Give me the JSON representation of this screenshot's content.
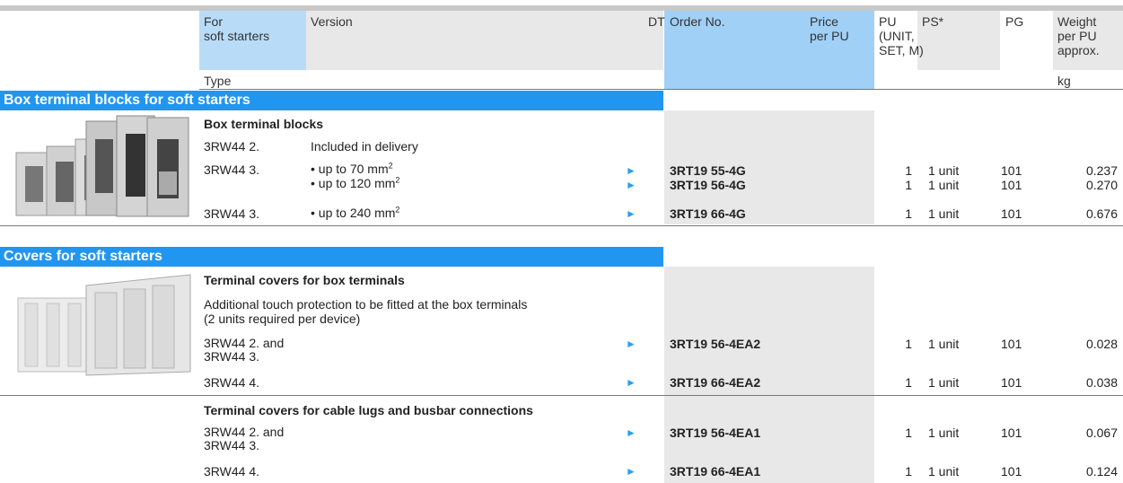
{
  "header": {
    "for_label": "For\nsoft starters",
    "version_label": "Version",
    "dt_label": "DT",
    "order_label": "Order No.",
    "price_label": "Price\nper PU",
    "pu_label": "PU\n(UNIT,\nSET, M)",
    "ps_label": "PS*",
    "pg_label": "PG",
    "weight_label": "Weight\nper PU\napprox.",
    "type_label": "Type",
    "kg_label": "kg"
  },
  "sections": {
    "box_title": "Box terminal blocks for soft starters",
    "covers_title": "Covers for soft starters"
  },
  "box": {
    "subtitle": "Box terminal blocks",
    "row0": {
      "type": "3RW44 2.",
      "version": "Included in delivery"
    },
    "row1": {
      "type": "3RW44 3.",
      "v1": "• up to 70 mm",
      "v2": "• up to 120 mm",
      "o1": "3RT19 55-4G",
      "o2": "3RT19 56-4G",
      "pu1": "1",
      "pu2": "1",
      "ps1": "1 unit",
      "ps2": "1 unit",
      "pg1": "101",
      "pg2": "101",
      "w1": "0.237",
      "w2": "0.270"
    },
    "row2": {
      "type": "3RW44 3.",
      "version": "• up to 240 mm",
      "order": "3RT19 66-4G",
      "pu": "1",
      "ps": "1 unit",
      "pg": "101",
      "weight": "0.676"
    },
    "sup": "2"
  },
  "covers_box": {
    "subtitle": "Terminal covers for box terminals",
    "desc": "Additional touch protection to be fitted at the box terminals\n(2 units required per device)",
    "row1": {
      "type": "3RW44 2. and\n3RW44 3.",
      "order": "3RT19 56-4EA2",
      "pu": "1",
      "ps": "1 unit",
      "pg": "101",
      "weight": "0.028"
    },
    "row2": {
      "type": "3RW44 4.",
      "order": "3RT19 66-4EA2",
      "pu": "1",
      "ps": "1 unit",
      "pg": "101",
      "weight": "0.038"
    }
  },
  "covers_lugs": {
    "subtitle": "Terminal covers for cable lugs and busbar connections",
    "row1": {
      "type": "3RW44 2. and\n3RW44 3.",
      "order": "3RT19 56-4EA1",
      "pu": "1",
      "ps": "1 unit",
      "pg": "101",
      "weight": "0.067"
    },
    "row2": {
      "type": "3RW44 4.",
      "order": "3RT19 66-4EA1",
      "pu": "1",
      "ps": "1 unit",
      "pg": "101",
      "weight": "0.124"
    }
  },
  "arrow_icon": "play-arrow-icon",
  "colors": {
    "section": "#2196f0",
    "header_blue": "#b8dcf8",
    "order_blue": "#a0d0f6",
    "grey": "#e8e8e8",
    "arrow": "#2aa0f0"
  }
}
